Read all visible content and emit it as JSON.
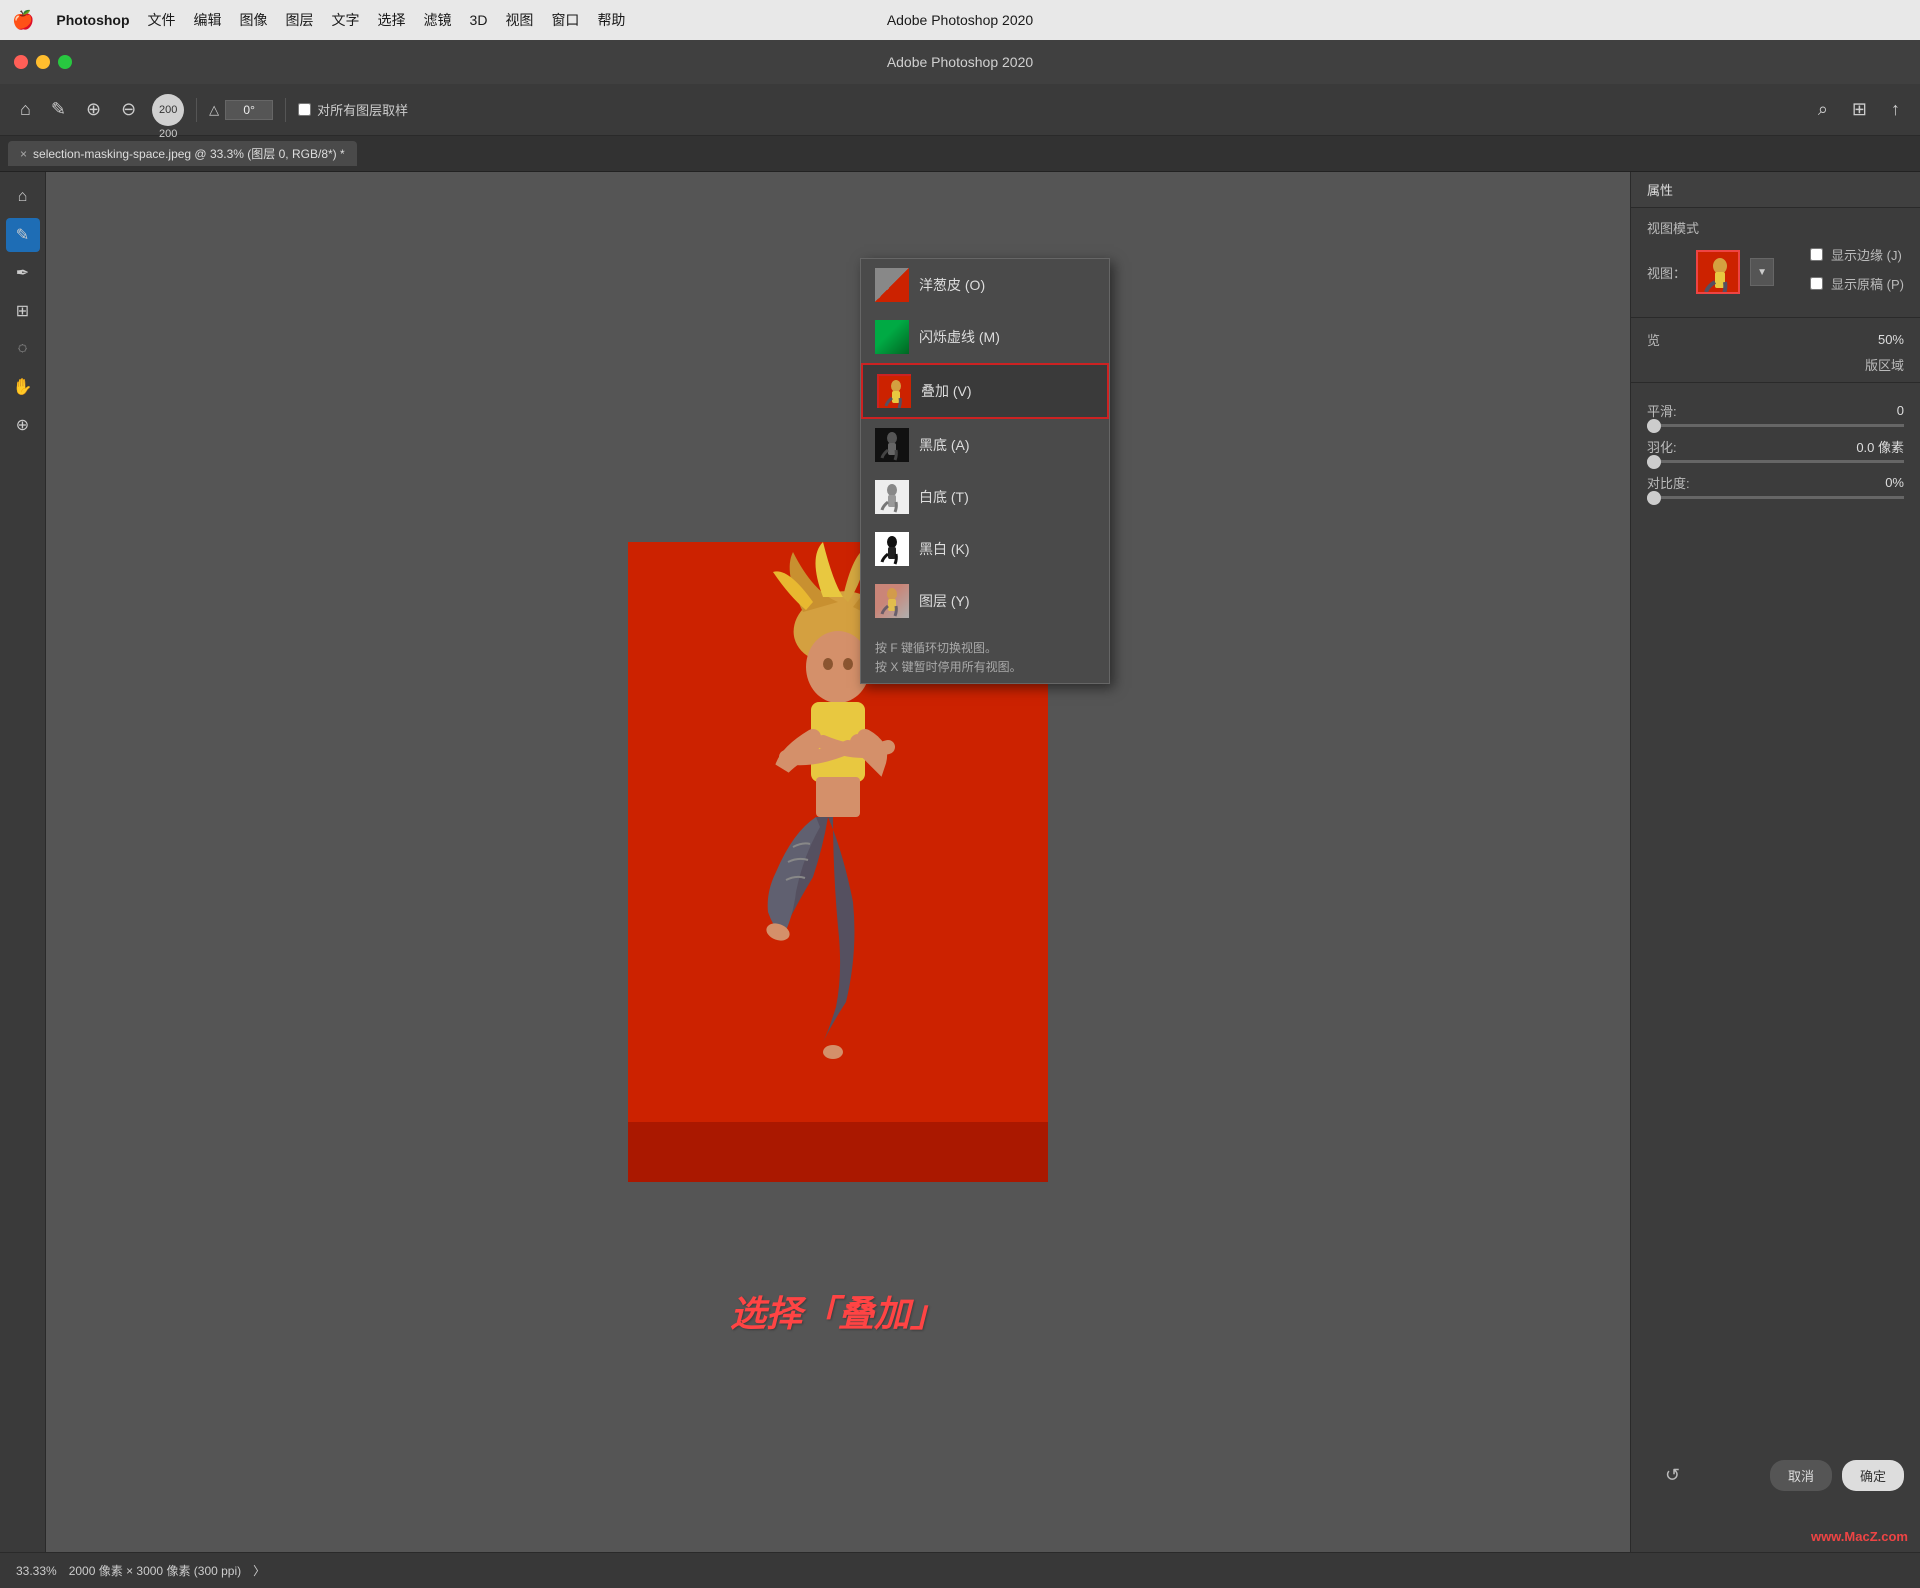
{
  "menubar": {
    "apple": "🍎",
    "app_name": "Photoshop",
    "items": [
      "文件",
      "编辑",
      "图像",
      "图层",
      "文字",
      "选择",
      "滤镜",
      "3D",
      "视图",
      "窗口",
      "帮助"
    ],
    "title": "Adobe Photoshop 2020"
  },
  "titlebar": {
    "title": "Adobe Photoshop 2020"
  },
  "toolbar": {
    "brush_size": "200",
    "angle_label": "△",
    "angle_value": "0°",
    "sample_all_label": "对所有图层取样"
  },
  "tab": {
    "close": "×",
    "title": "selection-masking-space.jpeg @ 33.3% (图层 0, RGB/8*) *"
  },
  "left_tools": [
    "🏠",
    "✏️",
    "⊕",
    "⊖",
    "◯",
    "↕",
    "✱",
    "∿",
    "⬡",
    "✋",
    "🔍"
  ],
  "panel": {
    "title": "属性",
    "view_mode_title": "视图模式",
    "view_label": "视图：",
    "show_edge": "显示边缘 (J)",
    "show_original": "显示原稿 (P)",
    "preview_label": "览",
    "preview_opacity": "50%",
    "edge_detection_label": "版区域"
  },
  "dropdown": {
    "items": [
      {
        "id": "onion",
        "label": "洋葱皮 (O)",
        "key": "onion-skin"
      },
      {
        "id": "marching",
        "label": "闪烁虚线 (M)",
        "key": "marching-ants"
      },
      {
        "id": "overlay",
        "label": "叠加 (V)",
        "key": "overlay",
        "selected": true
      },
      {
        "id": "black-bg",
        "label": "黑底 (A)",
        "key": "black-bg"
      },
      {
        "id": "white-bg",
        "label": "白底 (T)",
        "key": "white-bg"
      },
      {
        "id": "bw",
        "label": "黑白 (K)",
        "key": "bw"
      },
      {
        "id": "layer",
        "label": "图层 (Y)",
        "key": "layer"
      }
    ],
    "hint_line1": "按 F 键循环切换视图。",
    "hint_line2": "按 X 键暂时停用所有视图。"
  },
  "sliders": [
    {
      "label": "平滑:",
      "value": "0",
      "position": 0
    },
    {
      "label": "羽化:",
      "value": "0.0 像素",
      "position": 0
    },
    {
      "label": "对比度:",
      "value": "0%",
      "position": 0
    }
  ],
  "panel_buttons": {
    "reset": "↺",
    "cancel": "取消",
    "ok": "确定"
  },
  "statusbar": {
    "zoom": "33.33%",
    "dimensions": "2000 像素 × 3000 像素 (300 ppi)",
    "arrow": "〉"
  },
  "annotation": {
    "text": "选择「叠加」"
  },
  "watermark": "www.MacZ.com"
}
